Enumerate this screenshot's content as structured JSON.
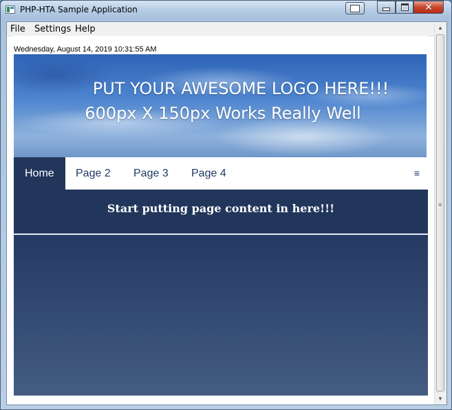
{
  "window": {
    "title": "PHP-HTA Sample Application",
    "close_glyph": "✕"
  },
  "menu": {
    "items": [
      "File",
      "Settings",
      "Help"
    ]
  },
  "datetime": "Wednesday, August 14, 2019 10:31:55 AM",
  "logo": {
    "line1": "PUT YOUR AWESOME LOGO HERE!!!",
    "line2": "600px X 150px Works Really Well"
  },
  "nav": {
    "items": [
      "Home",
      "Page 2",
      "Page 3",
      "Page 4"
    ],
    "active": "Home",
    "menu_icon": "≡"
  },
  "content": {
    "banner": "Start putting page content in here!!!"
  },
  "scrollbar": {
    "up_arrow": "▲",
    "down_arrow": "▼",
    "grip": "≡"
  },
  "colors": {
    "nav_active_bg": "#22365c",
    "nav_text": "#1f3a63",
    "banner_bg": "#22365c"
  },
  "icons": {
    "app": "app-icon",
    "minimize": "minimize-icon",
    "maximize": "maximize-icon",
    "close": "close-icon",
    "nav_menu": "hamburger-icon"
  }
}
